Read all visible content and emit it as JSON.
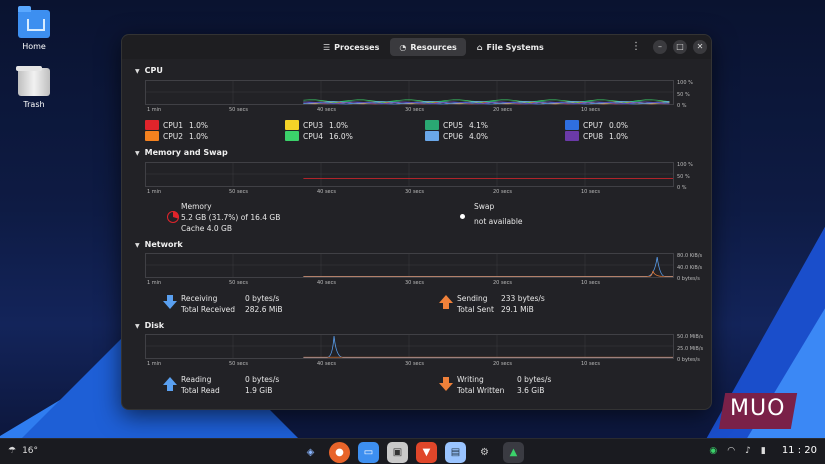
{
  "desktop": {
    "icons": [
      {
        "label": "Home"
      },
      {
        "label": "Trash"
      }
    ]
  },
  "window": {
    "tabs": [
      {
        "label": "Processes",
        "icon": "list-icon"
      },
      {
        "label": "Resources",
        "icon": "gauge-icon",
        "active": true
      },
      {
        "label": "File Systems",
        "icon": "drive-icon"
      }
    ]
  },
  "x_axis_labels": [
    "1 min",
    "50 secs",
    "40 secs",
    "30 secs",
    "20 secs",
    "10 secs"
  ],
  "cpu": {
    "title": "CPU",
    "y_labels": [
      "100 %",
      "50 %",
      "0 %"
    ],
    "cores": [
      {
        "name": "CPU1",
        "value": "1.0%",
        "color": "#e0242b"
      },
      {
        "name": "CPU2",
        "value": "1.0%",
        "color": "#f5821f"
      },
      {
        "name": "CPU3",
        "value": "1.0%",
        "color": "#f5d328"
      },
      {
        "name": "CPU4",
        "value": "16.0%",
        "color": "#3bd16a"
      },
      {
        "name": "CPU5",
        "value": "4.1%",
        "color": "#2aa873"
      },
      {
        "name": "CPU6",
        "value": "4.0%",
        "color": "#6aa7e8"
      },
      {
        "name": "CPU7",
        "value": "0.0%",
        "color": "#2f6fe0"
      },
      {
        "name": "CPU8",
        "value": "1.0%",
        "color": "#6b3aa8"
      }
    ]
  },
  "memory": {
    "title": "Memory and Swap",
    "y_labels": [
      "100 %",
      "50 %",
      "0 %"
    ],
    "memory_label": "Memory",
    "memory_usage": "5.2 GB (31.7%) of 16.4 GB",
    "cache": "Cache 4.0 GB",
    "memory_color": "#e0242b",
    "swap_label": "Swap",
    "swap_status": "not available"
  },
  "network": {
    "title": "Network",
    "y_labels": [
      "80.0 KiB/s",
      "40.0 KiB/s",
      "0 bytes/s"
    ],
    "receiving_label": "Receiving",
    "receiving_value": "0 bytes/s",
    "total_received_label": "Total Received",
    "total_received_value": "282.6 MiB",
    "sending_label": "Sending",
    "sending_value": "233 bytes/s",
    "total_sent_label": "Total Sent",
    "total_sent_value": "29.1 MiB"
  },
  "disk": {
    "title": "Disk",
    "y_labels": [
      "50.0 MiB/s",
      "25.0 MiB/s",
      "0 bytes/s"
    ],
    "reading_label": "Reading",
    "reading_value": "0 bytes/s",
    "total_read_label": "Total Read",
    "total_read_value": "1.9 GiB",
    "writing_label": "Writing",
    "writing_value": "0 bytes/s",
    "total_written_label": "Total Written",
    "total_written_value": "3.6 GiB"
  },
  "taskbar": {
    "temperature": "16°",
    "clock": "11 : 20"
  },
  "watermark": "MUO"
}
